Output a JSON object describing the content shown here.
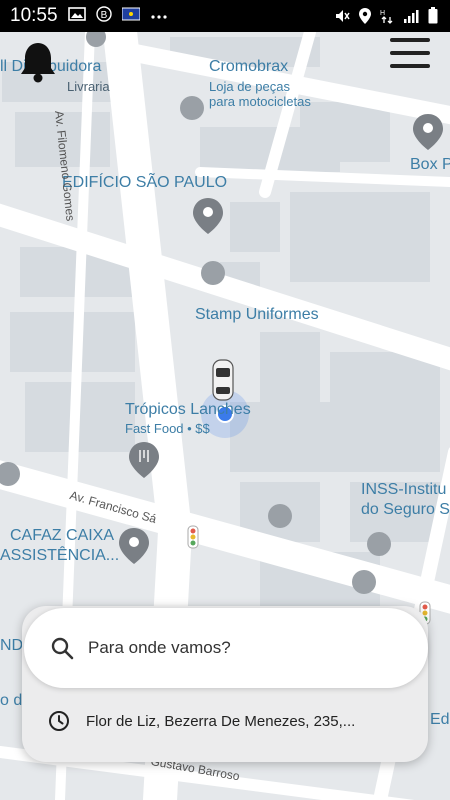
{
  "status_bar": {
    "time": "10:55",
    "left_icons": [
      "image-icon",
      "b-badge-icon",
      "flag-icon",
      "more-dots-icon"
    ],
    "right_icons": [
      "mute-icon",
      "location-icon",
      "data-icon",
      "signal-icon",
      "battery-icon"
    ]
  },
  "map": {
    "poi_labels": {
      "distribuidora": "ll Distribuidora",
      "livraria": "Livraria",
      "cromobrax": "Cromobrax",
      "cromobrax_sub1": "Loja de peças",
      "cromobrax_sub2": "para motocicletas",
      "boxp": "Box P",
      "edificio": "EDIFÍCIO SÃO PAULO",
      "stamp": "Stamp Uniformes",
      "tropicos": "Trópicos Lanches",
      "tropicos_sub": "Fast Food • $$",
      "inss1": "INSS-Institu",
      "inss2": "do Seguro S",
      "cafaz1": "CAFAZ CAIXA",
      "cafaz2": "ASSISTÊNCIA...",
      "edge_ndc": "NDC",
      "edge_o": "o de",
      "edge_ed": "Ed"
    },
    "street_labels": {
      "filomeno": "Av. Filomeno Gomes",
      "francisco": "Av. Francisco Sá",
      "gustavo": "Gustavo Barroso"
    }
  },
  "controls": {
    "notifications_icon": "bell-icon",
    "menu_icon": "hamburger-menu-icon"
  },
  "bottom_sheet": {
    "search_placeholder": "Para onde vamos?",
    "recent_destination": "Flor de Liz, Bezerra De Menezes, 235,..."
  },
  "colors": {
    "map_bg": "#e5e8eb",
    "road": "#ffffff",
    "block": "#d6dbe0",
    "poi_text": "#3d7ea6",
    "location_dot": "#3b7bea"
  }
}
